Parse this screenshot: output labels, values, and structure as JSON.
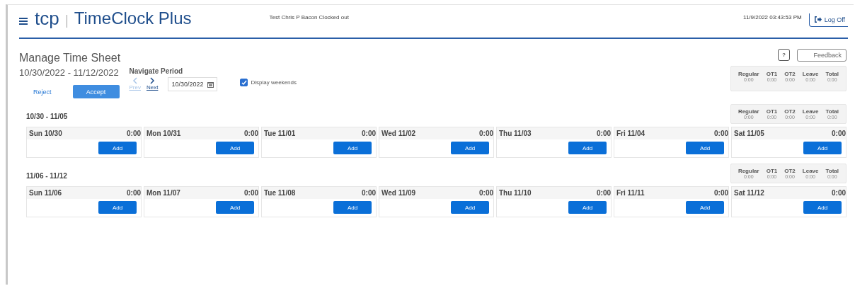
{
  "header": {
    "logo": "tcp",
    "product": "TimeClock Plus",
    "status": "Test Chris P Bacon Clocked out",
    "datetime": "11/9/2022 03:43:53 PM",
    "logoff": "Log Off"
  },
  "page": {
    "title": "Manage Time Sheet",
    "period": "10/30/2022 - 11/12/2022",
    "help": "?",
    "feedback": "Feedback",
    "reject": "Reject",
    "accept": "Accept",
    "navigate_label": "Navigate Period",
    "prev": {
      "label": "Prev",
      "disabled": true
    },
    "next": {
      "label": "Next",
      "disabled": false
    },
    "date": "10/30/2022",
    "display_weekends": {
      "label": "Display weekends",
      "checked": true
    }
  },
  "summary": [
    {
      "label": "Regular",
      "value": "0:00"
    },
    {
      "label": "OT1",
      "value": "0:00"
    },
    {
      "label": "OT2",
      "value": "0:00"
    },
    {
      "label": "Leave",
      "value": "0:00"
    },
    {
      "label": "Total",
      "value": "0:00"
    }
  ],
  "weeks": [
    {
      "title": "10/30 - 11/05",
      "summary": [
        {
          "label": "Regular",
          "value": "0:00"
        },
        {
          "label": "OT1",
          "value": "0:00"
        },
        {
          "label": "OT2",
          "value": "0:00"
        },
        {
          "label": "Leave",
          "value": "0:00"
        },
        {
          "label": "Total",
          "value": "0:00"
        }
      ],
      "days": [
        {
          "label": "Sun 10/30",
          "hours": "0:00",
          "button": "Add"
        },
        {
          "label": "Mon 10/31",
          "hours": "0:00",
          "button": "Add"
        },
        {
          "label": "Tue 11/01",
          "hours": "0:00",
          "button": "Add"
        },
        {
          "label": "Wed 11/02",
          "hours": "0:00",
          "button": "Add"
        },
        {
          "label": "Thu 11/03",
          "hours": "0:00",
          "button": "Add"
        },
        {
          "label": "Fri 11/04",
          "hours": "0:00",
          "button": "Add"
        },
        {
          "label": "Sat 11/05",
          "hours": "0:00",
          "button": "Add"
        }
      ]
    },
    {
      "title": "11/06 - 11/12",
      "summary": [
        {
          "label": "Regular",
          "value": "0:00"
        },
        {
          "label": "OT1",
          "value": "0:00"
        },
        {
          "label": "OT2",
          "value": "0:00"
        },
        {
          "label": "Leave",
          "value": "0:00"
        },
        {
          "label": "Total",
          "value": "0:00"
        }
      ],
      "days": [
        {
          "label": "Sun 11/06",
          "hours": "0:00",
          "button": "Add"
        },
        {
          "label": "Mon 11/07",
          "hours": "0:00",
          "button": "Add"
        },
        {
          "label": "Tue 11/08",
          "hours": "0:00",
          "button": "Add"
        },
        {
          "label": "Wed 11/09",
          "hours": "0:00",
          "button": "Add"
        },
        {
          "label": "Thu 11/10",
          "hours": "0:00",
          "button": "Add"
        },
        {
          "label": "Fri 11/11",
          "hours": "0:00",
          "button": "Add"
        },
        {
          "label": "Sat 11/12",
          "hours": "0:00",
          "button": "Add"
        }
      ]
    }
  ]
}
